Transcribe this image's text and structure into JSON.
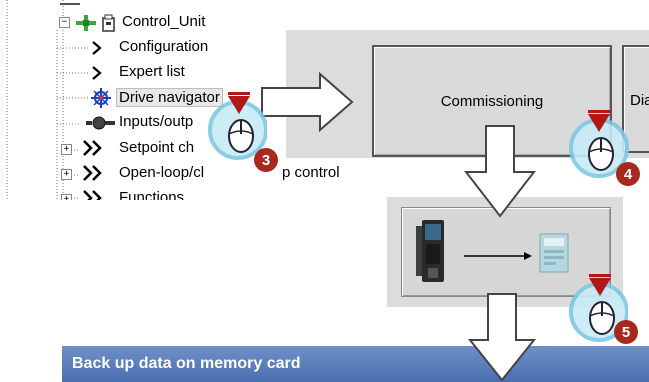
{
  "tree": {
    "root_label": "Control_Unit",
    "items": [
      {
        "label": "Configuration"
      },
      {
        "label": "Expert list"
      },
      {
        "label": "Drive navigator"
      },
      {
        "label": "Inputs/outp"
      },
      {
        "label": "Setpoint ch"
      },
      {
        "label": "Open-loop/cl"
      },
      {
        "label": "Functions"
      }
    ],
    "overlap_text": "p control"
  },
  "buttons": {
    "commissioning": "Commissioning",
    "diagnostics_partial": "Dia"
  },
  "steps": [
    "3",
    "4",
    "5"
  ],
  "dialog": {
    "title": "Back up data on memory card"
  },
  "colors": {
    "title_bar": "#5a7dbf",
    "badge": "#a8281e",
    "panel": "#dcdcdc",
    "mouse_ring": "#7ec8e3"
  }
}
